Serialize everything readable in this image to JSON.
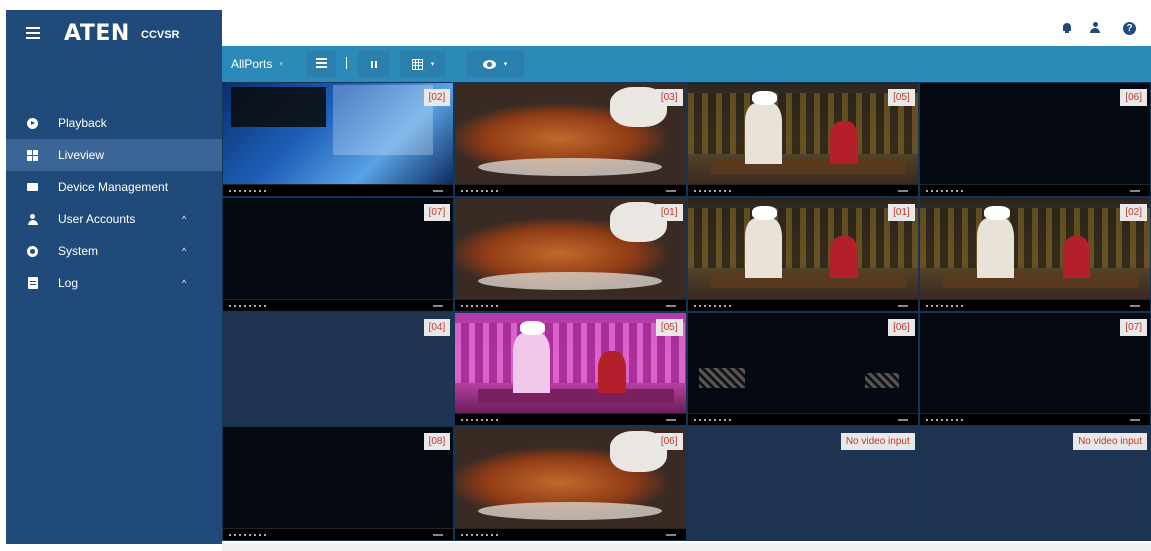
{
  "sidebar": {
    "brand": "ATEN",
    "product": "CCVSR",
    "items": [
      {
        "label": "Playback",
        "icon": "play-icon",
        "caret": ""
      },
      {
        "label": "Liveview",
        "icon": "grid-icon",
        "caret": "",
        "active": true
      },
      {
        "label": "Device Management",
        "icon": "device-icon",
        "caret": ""
      },
      {
        "label": "User Accounts",
        "icon": "user-icon",
        "caret": "^"
      },
      {
        "label": "System",
        "icon": "gear-icon",
        "caret": "^"
      },
      {
        "label": "Log",
        "icon": "log-icon",
        "caret": "^"
      }
    ]
  },
  "topbar": {
    "icons": [
      "bell-icon",
      "person-icon",
      "help-icon"
    ],
    "help_glyph": "?"
  },
  "toolbar": {
    "ports_label": "AllPorts",
    "ports_caret": "▾",
    "layout_caret": "▾",
    "view_caret": "▾"
  },
  "tiles": [
    {
      "label": "[02]",
      "scene": "windows"
    },
    {
      "label": "[03]",
      "scene": "duck"
    },
    {
      "label": "[05]",
      "scene": "chef"
    },
    {
      "label": "[06]",
      "scene": "black"
    },
    {
      "label": "[07]",
      "scene": "black"
    },
    {
      "label": "[01]",
      "scene": "duck"
    },
    {
      "label": "[01]",
      "scene": "chef"
    },
    {
      "label": "[02]",
      "scene": "chef"
    },
    {
      "label": "[04]",
      "scene": "empty"
    },
    {
      "label": "[05]",
      "scene": "pink"
    },
    {
      "label": "[06]",
      "scene": "noise"
    },
    {
      "label": "[07]",
      "scene": "black"
    },
    {
      "label": "[08]",
      "scene": "black"
    },
    {
      "label": "[06]",
      "scene": "duck"
    },
    {
      "label": "No video input",
      "scene": "novideo"
    },
    {
      "label": "No video input",
      "scene": "novideo"
    }
  ],
  "colors": {
    "sidebar": "#1f4a7a",
    "sidebar_active": "#3b6596",
    "toolbar": "#2b8ab8",
    "label_text": "#c0392b"
  }
}
